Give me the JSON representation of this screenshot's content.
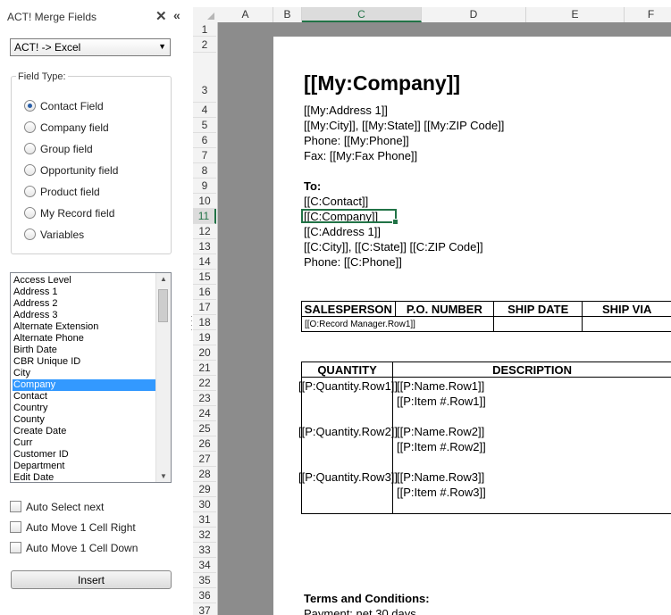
{
  "pane": {
    "title": "ACT! Merge Fields",
    "close_glyph": "✕",
    "collapse_glyph": "«",
    "direction": "ACT! -> Excel",
    "field_type_label": "Field Type:",
    "field_types": [
      {
        "label": "Contact Field",
        "selected": true
      },
      {
        "label": "Company field",
        "selected": false
      },
      {
        "label": "Group field",
        "selected": false
      },
      {
        "label": "Opportunity field",
        "selected": false
      },
      {
        "label": "Product field",
        "selected": false
      },
      {
        "label": "My Record field",
        "selected": false
      },
      {
        "label": "Variables",
        "selected": false
      }
    ],
    "fields": [
      "Access Level",
      "Address 1",
      "Address 2",
      "Address 3",
      "Alternate Extension",
      "Alternate Phone",
      "Birth Date",
      "CBR Unique ID",
      "City",
      "Company",
      "Contact",
      "Country",
      "County",
      "Create Date",
      "Curr",
      "Customer ID",
      "Department",
      "Edit Date"
    ],
    "selected_field": "Company",
    "options": [
      "Auto Select next",
      "Auto Move 1 Cell Right",
      "Auto Move 1 Cell Down"
    ],
    "insert_label": "Insert"
  },
  "sheet": {
    "columns": [
      "A",
      "B",
      "C",
      "D",
      "E",
      "F"
    ],
    "active_column": "C",
    "rows": [
      "1",
      "2",
      "3",
      "4",
      "5",
      "6",
      "7",
      "8",
      "9",
      "10",
      "11",
      "12",
      "13",
      "14",
      "15",
      "16",
      "17",
      "18",
      "19",
      "20",
      "21",
      "22",
      "23",
      "24",
      "25",
      "26",
      "27",
      "28",
      "29",
      "30",
      "31",
      "32",
      "33",
      "34",
      "35",
      "36",
      "37"
    ],
    "active_row": "11",
    "company_title": "[[My:Company]]",
    "my_address": "[[My:Address 1]]",
    "my_city_line": "[[My:City]], [[My:State]] [[My:ZIP Code]]",
    "my_phone": "Phone: [[My:Phone]]",
    "my_fax": "Fax: [[My:Fax Phone]]",
    "to_label": "To:",
    "c_contact": "[[C:Contact]]",
    "c_company": "[[C:Company]]",
    "c_address": "[[C:Address 1]]",
    "c_city_line": "[[C:City]], [[C:State]] [[C:ZIP Code]]",
    "c_phone": "Phone: [[C:Phone]]",
    "sales_headers": [
      "SALESPERSON",
      "P.O. NUMBER",
      "SHIP DATE",
      "SHIP VIA"
    ],
    "sales_row": "[[O:Record Manager.Row1]]",
    "item_headers": [
      "QUANTITY",
      "DESCRIPTION"
    ],
    "items": [
      {
        "qty": "[[P:Quantity.Row1]]",
        "name": "[[P:Name.Row1]]",
        "item": "[[P:Item #.Row1]]"
      },
      {
        "qty": "[[P:Quantity.Row2]]",
        "name": "[[P:Name.Row2]]",
        "item": "[[P:Item #.Row2]]"
      },
      {
        "qty": "[[P:Quantity.Row3]]",
        "name": "[[P:Name.Row3]]",
        "item": "[[P:Item #.Row3]]"
      }
    ],
    "terms_label": "Terms and Conditions:",
    "payment": "Payment: net 30 days"
  }
}
